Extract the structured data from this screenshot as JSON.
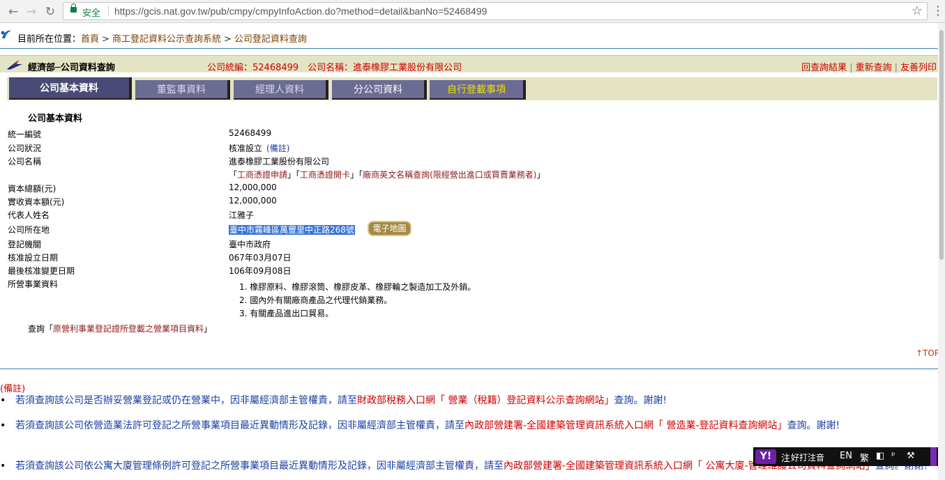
{
  "browser": {
    "secure_label": "安全",
    "url": "https://gcis.nat.gov.tw/pub/cmpy/cmpyInfoAction.do?method=detail&banNo=52468499"
  },
  "breadcrumb": {
    "prefix": "目前所在位置：",
    "home": "首頁",
    "level1": "商工登記資料公示查詢系統",
    "level2": "公司登記資料查詢",
    "separator": ">"
  },
  "titlebar": {
    "title": "經濟部─公司資料查詢",
    "company_id": "公司統編：52468499　公司名稱：進泰橡膠工業股份有限公司",
    "link_back": "回查詢結果",
    "link_new": "重新查詢",
    "link_print": "友善列印",
    "link_sep": "|"
  },
  "tabs": [
    {
      "label": "公司基本資料",
      "state": "active"
    },
    {
      "label": "董監事資料",
      "state": "inactive"
    },
    {
      "label": "經理人資料",
      "state": "inactive"
    },
    {
      "label": "分公司資料",
      "state": "normal"
    },
    {
      "label": "自行登載事項",
      "state": "yellow"
    }
  ],
  "section_title": "公司基本資料",
  "fields": {
    "ban_label": "統一編號",
    "ban": "52468499",
    "status_label": "公司狀況",
    "status": "核准設立",
    "status_note": "(備註)",
    "name_label": "公司名稱",
    "name": "進泰橡膠工業股份有限公司",
    "link_apply": "工商憑證申請",
    "link_card": "工商憑證開卡",
    "link_english": "廠商英文名稱查詢(限經營出進口或買賣業務者)",
    "capital_label": "資本總額(元)",
    "capital": "12,000,000",
    "paid_label": "實收資本額(元)",
    "paid": "12,000,000",
    "rep_label": "代表人姓名",
    "rep": "江雅子",
    "addr_label": "公司所在地",
    "addr": "臺中市霧峰區萬豐里中正路268號",
    "map_button": "電子地圖",
    "authority_label": "登記機關",
    "authority": "臺中市政府",
    "est_label": "核准設立日期",
    "est": "067年03月07日",
    "change_label": "最後核准變更日期",
    "change": "106年09月08日",
    "biz_label": "所營事業資料"
  },
  "business_items": [
    "1. 橡膠原料、橡膠滾筒、橡膠皮革、橡膠輪之製造加工及外銷。",
    "2. 國內外有關廠商產品之代理代銷業務。",
    "3. 有關產品進出口貿易。"
  ],
  "query": {
    "prefix": "查詢「",
    "link": "原營利事業登記證所登載之營業項目資料",
    "suffix": "」"
  },
  "top_link": "↑TOP",
  "remarks": {
    "heading": "(備註)",
    "note1_pre": "若須查詢該公司是否辦妥營業登記或仍在營業中，因非屬經濟部主管權責，請至",
    "note1_red": "財政部稅務入口網「 營業（稅籍）登記資料公示查詢網站」",
    "note1_post": "查詢。謝謝!",
    "note2_pre": "若須查詢該公司依營造業法許可登記之所營事業項目最近異動情形及記錄，因非屬經濟部主管權責，請至",
    "note2_red": "內政部營建署-全國建築管理資訊系統入口網「 營造業-登記資料查詢網站」",
    "note2_post": "查詢。謝謝!",
    "note3_pre": "若須查詢該公司依公寓大廈管理條例許可登記之所營事業項目最近異動情形及記錄，因非屬經濟部主管權責，請至",
    "note3_red": "內政部營建署-全國建築管理資訊系統入口網「 公寓大廈-管理維護公司資料查詢網站」",
    "note3_post": "查詢。謝謝!"
  },
  "ime": {
    "logo": "Y!",
    "mode_char": "注",
    "mode_name": "好打注音",
    "lang": "EN",
    "script": "繁"
  }
}
